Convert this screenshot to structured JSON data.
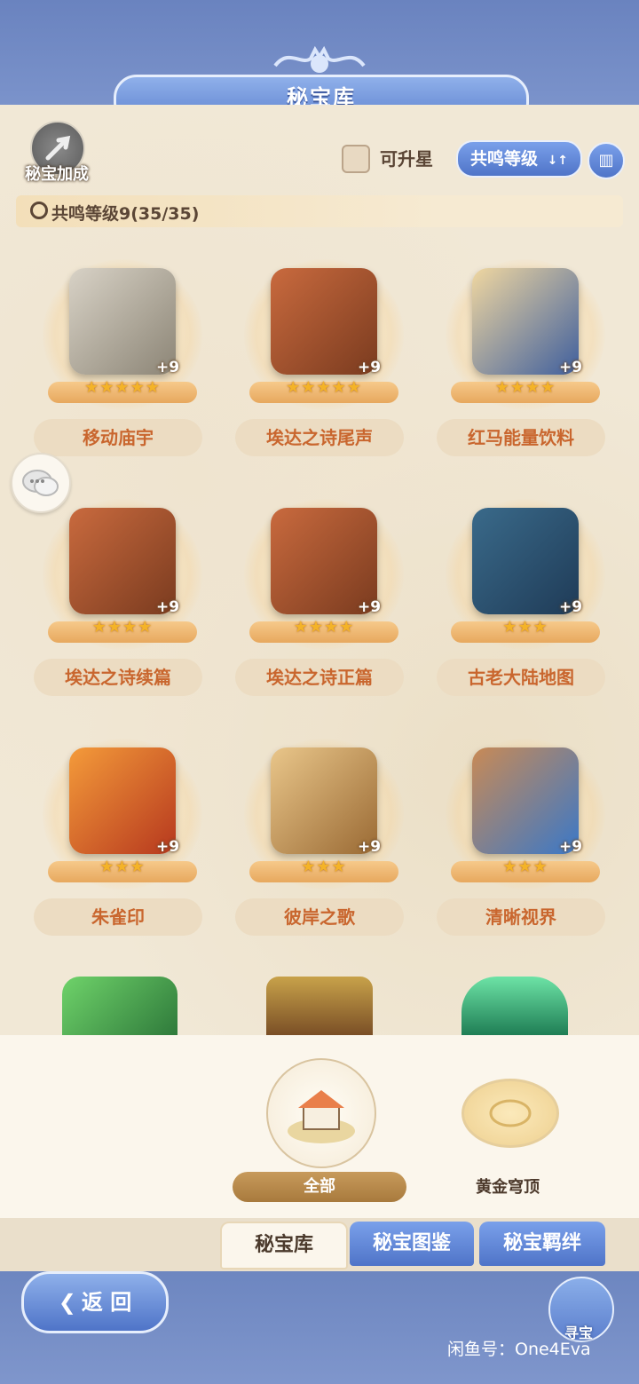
{
  "header": {
    "title": "秘宝库"
  },
  "controls": {
    "boost_label": "秘宝加成",
    "upgradable_label": "可升星",
    "sort_label": "共鸣等级",
    "sort_arrow": "↓↑",
    "codex_icon": "book-icon"
  },
  "resonance": {
    "text": "共鸣等级9(35/35)"
  },
  "items": [
    {
      "name": "移动庙宇",
      "stars": "★★★★★",
      "plus": "+9",
      "icon": "temple-icon"
    },
    {
      "name": "埃达之诗尾声",
      "stars": "★★★★★",
      "plus": "+9",
      "icon": "book-icon"
    },
    {
      "name": "红马能量饮料",
      "stars": "★★★★",
      "plus": "+9",
      "icon": "can-icon"
    },
    {
      "name": "埃达之诗续篇",
      "stars": "★★★★",
      "plus": "+9",
      "icon": "book-icon"
    },
    {
      "name": "埃达之诗正篇",
      "stars": "★★★★",
      "plus": "+9",
      "icon": "book-icon"
    },
    {
      "name": "古老大陆地图",
      "stars": "★★★",
      "plus": "+9",
      "icon": "map-icon"
    },
    {
      "name": "朱雀印",
      "stars": "★★★",
      "plus": "+9",
      "icon": "phoenix-icon"
    },
    {
      "name": "彼岸之歌",
      "stars": "★★★",
      "plus": "+9",
      "icon": "lute-icon"
    },
    {
      "name": "清晰视界",
      "stars": "★★★",
      "plus": "+9",
      "icon": "goggles-icon"
    }
  ],
  "filters": {
    "all_label": "全部",
    "gold_label": "黄金穹顶"
  },
  "tabs": [
    "秘宝库",
    "秘宝图鉴",
    "秘宝羁绊"
  ],
  "footer": {
    "back_label": "返 回",
    "hunt_label": "寻宝",
    "watermark": "闲鱼号：One4Eva"
  },
  "colors": {
    "accent_blue": "#5f82cf",
    "name_orange": "#c9662e",
    "parchment": "#f1e8d6"
  }
}
